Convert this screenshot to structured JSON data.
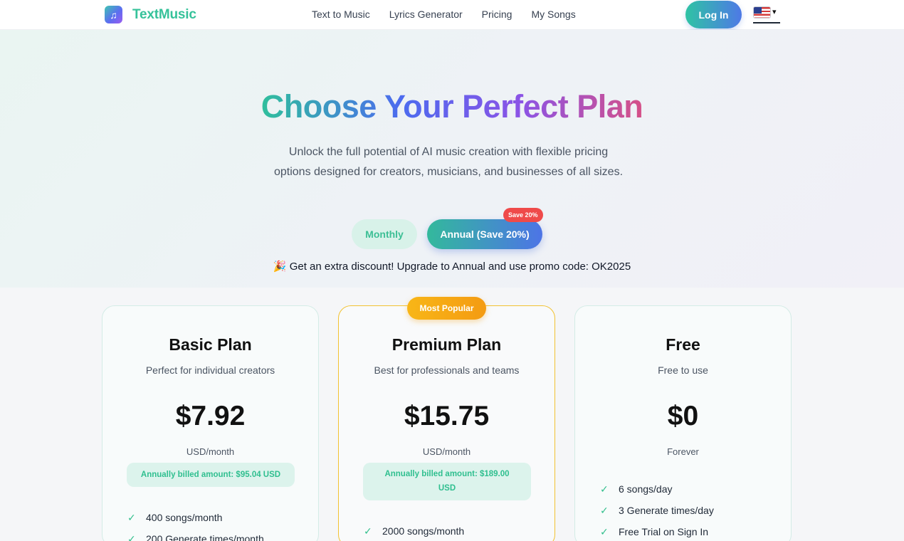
{
  "nav": {
    "logo_text": "TextMusic",
    "logo_icon": "music-note-icon",
    "links": [
      "Text to Music",
      "Lyrics Generator",
      "Pricing",
      "My Songs"
    ],
    "login_label": "Log In",
    "language_flag": "us-flag-icon"
  },
  "hero": {
    "title": "Choose Your Perfect Plan",
    "subtitle": "Unlock the full potential of AI music creation with flexible pricing options designed for creators, musicians, and businesses of all sizes.",
    "toggle_monthly": "Monthly",
    "toggle_annual": "Annual (Save 20%)",
    "save_badge": "Save 20%",
    "promo_emoji": "🎉",
    "promo_text": "Get an extra discount! Upgrade to Annual and use promo code: OK2025"
  },
  "plans": [
    {
      "title": "Basic Plan",
      "description": "Perfect for individual creators",
      "price": "$7.92",
      "period": "USD/month",
      "billed": "Annually billed amount: $95.04 USD",
      "features": [
        "400 songs/month",
        "200 Generate times/month"
      ]
    },
    {
      "title": "Premium Plan",
      "badge": "Most Popular",
      "description": "Best for professionals and teams",
      "price": "$15.75",
      "period": "USD/month",
      "billed_line1": "Annually billed amount: $189.00",
      "billed_line2": "USD",
      "features": [
        "2000 songs/month"
      ]
    },
    {
      "title": "Free",
      "description": "Free to use",
      "price": "$0",
      "period": "Forever",
      "features": [
        "6 songs/day",
        "3 Generate times/day",
        "Free Trial on Sign In"
      ]
    }
  ],
  "colors": {
    "brand_green": "#36c29a",
    "brand_blue": "#4e79e6",
    "popular_orange": "#f8b617",
    "save_red": "#ef4a4a",
    "check_green": "#31bf8c"
  }
}
